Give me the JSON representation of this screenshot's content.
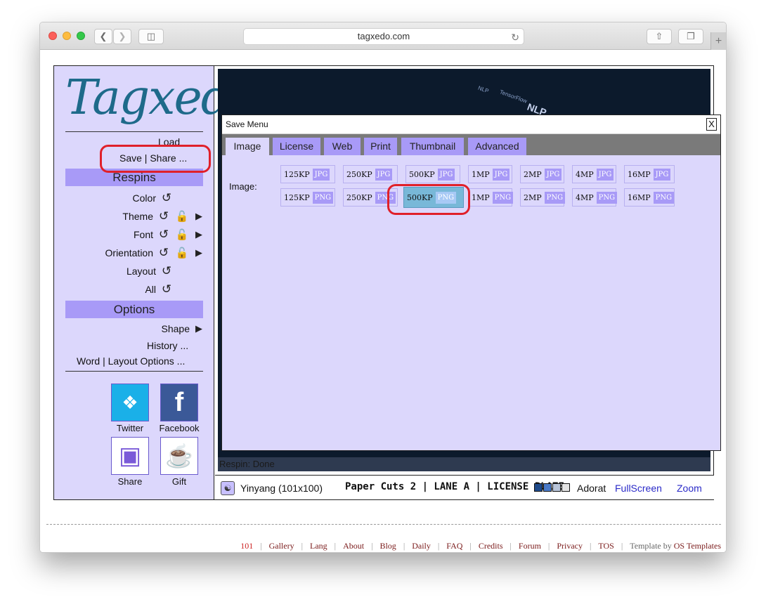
{
  "browser": {
    "url": "tagxedo.com"
  },
  "sidebar": {
    "logo": "Tagxedo",
    "load_label": "Load",
    "save_share_label": "Save | Share ...",
    "respins_header": "Respins",
    "respins": [
      {
        "label": "Color"
      },
      {
        "label": "Theme"
      },
      {
        "label": "Font"
      },
      {
        "label": "Orientation"
      },
      {
        "label": "Layout"
      },
      {
        "label": "All"
      }
    ],
    "options_header": "Options",
    "shape_label": "Shape",
    "history_label": "History ...",
    "word_layout_label": "Word | Layout Options ...",
    "social": {
      "twitter": "Twitter",
      "facebook": "Facebook",
      "share": "Share",
      "gift": "Gift"
    }
  },
  "canvas": {
    "status": "Respin: Done"
  },
  "bottom_bar": {
    "shape_name": "Yinyang (101x100)",
    "font_samples": "Paper Cuts 2 | LANE A | LICENSE PLATE",
    "theme_name": "Adorat",
    "fullscreen_label": "FullScreen",
    "zoom_label": "Zoom",
    "theme_colors": [
      "#1e4a8a",
      "#4a7ac8",
      "#b8c4d8",
      "#e4e4e4"
    ]
  },
  "save_menu": {
    "title": "Save Menu",
    "close_label": "X",
    "tabs": [
      "Image",
      "License",
      "Web",
      "Print",
      "Thumbnail",
      "Advanced"
    ],
    "active_tab": "Image",
    "image_label": "Image:",
    "jpg_options": [
      {
        "size": "125KP",
        "format": "JPG"
      },
      {
        "size": "250KP",
        "format": "JPG"
      },
      {
        "size": "500KP",
        "format": "JPG"
      },
      {
        "size": "1MP",
        "format": "JPG"
      },
      {
        "size": "2MP",
        "format": "JPG"
      },
      {
        "size": "4MP",
        "format": "JPG"
      },
      {
        "size": "16MP",
        "format": "JPG"
      }
    ],
    "png_options": [
      {
        "size": "125KP",
        "format": "PNG"
      },
      {
        "size": "250KP",
        "format": "PNG"
      },
      {
        "size": "500KP",
        "format": "PNG"
      },
      {
        "size": "1MP",
        "format": "PNG"
      },
      {
        "size": "2MP",
        "format": "PNG"
      },
      {
        "size": "4MP",
        "format": "PNG"
      },
      {
        "size": "16MP",
        "format": "PNG"
      }
    ],
    "selected": "500KP PNG"
  },
  "footer": {
    "links": [
      "101",
      "Gallery",
      "Lang",
      "About",
      "Blog",
      "Daily",
      "FAQ",
      "Credits",
      "Forum",
      "Privacy",
      "TOS"
    ],
    "template_text": "Template by",
    "template_link": "OS Templates"
  }
}
